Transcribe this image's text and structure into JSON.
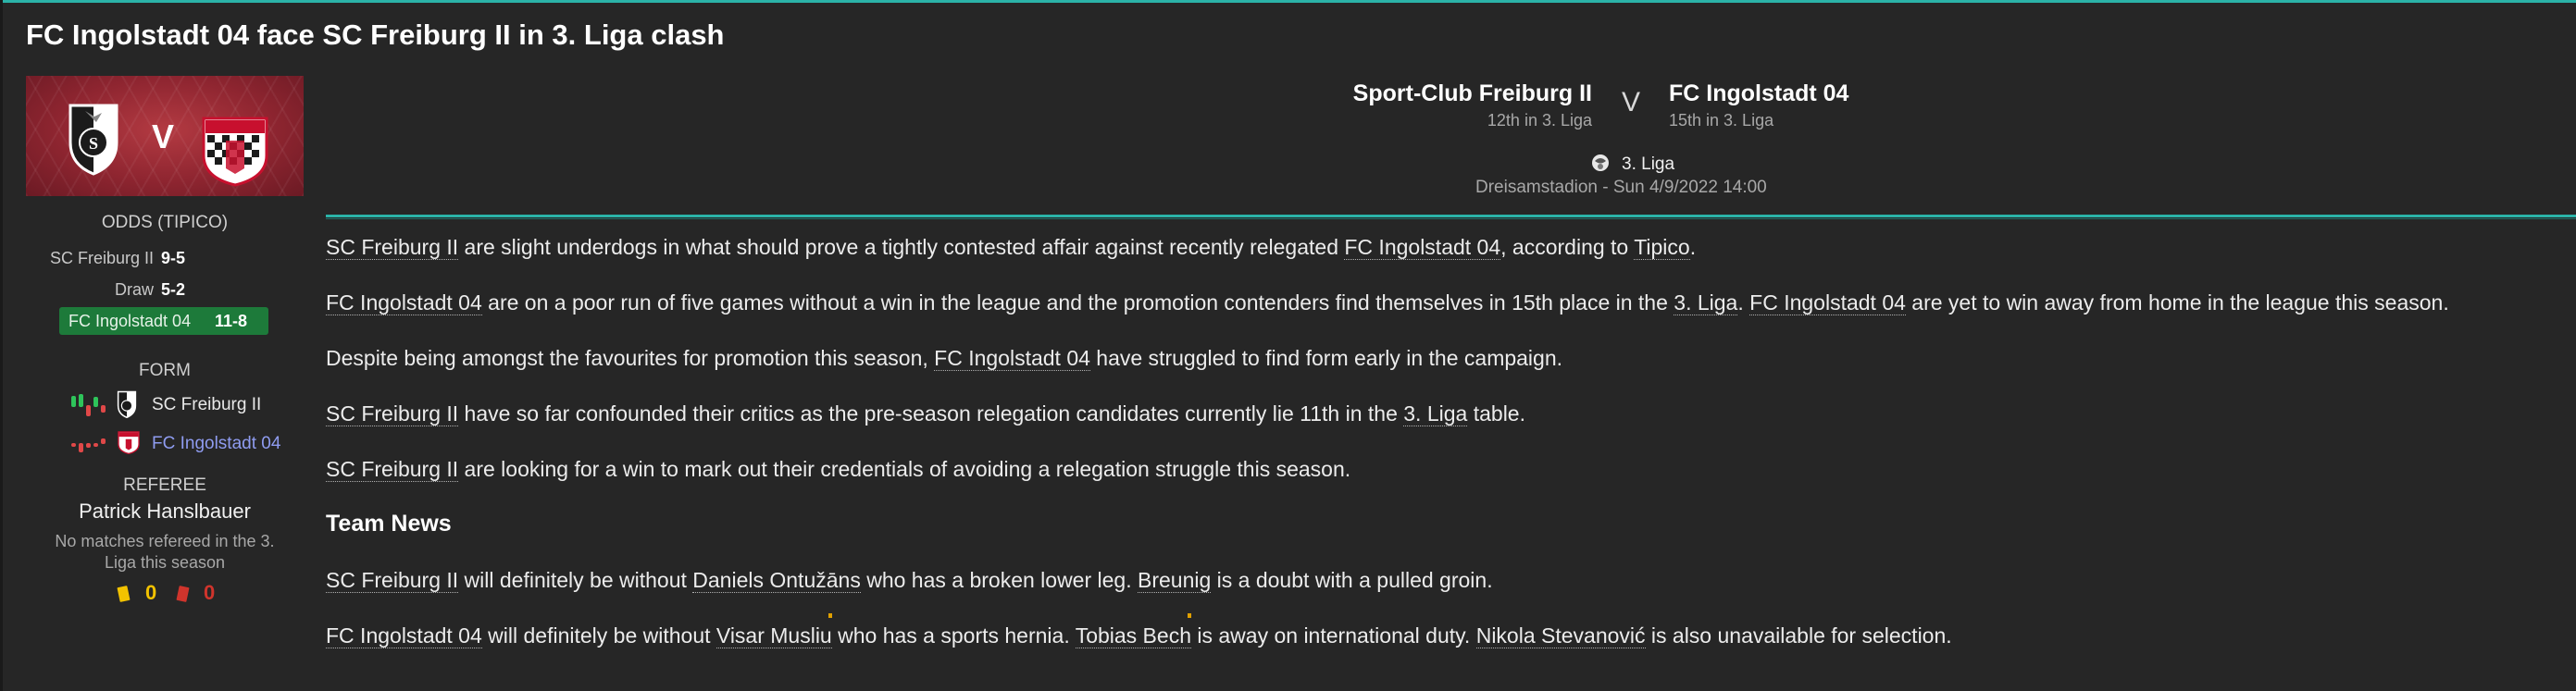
{
  "page": {
    "title": "FC Ingolstadt 04 face SC Freiburg II in 3. Liga clash"
  },
  "banner": {
    "home_icon": "sc-freiburg-crest",
    "away_icon": "fc-ingolstadt-crest",
    "versus": "V"
  },
  "odds": {
    "label": "ODDS (TIPICO)",
    "rows": [
      {
        "name": "SC Freiburg II",
        "value": "9-5"
      },
      {
        "name": "Draw",
        "value": "5-2"
      },
      {
        "name": "FC Ingolstadt 04",
        "value": "11-8",
        "favourite": true
      }
    ],
    "favourite_color": "#1d7a3a"
  },
  "form": {
    "label": "FORM",
    "rows": [
      {
        "team": "SC Freiburg II",
        "color": "#e8e8e8"
      },
      {
        "team": "FC Ingolstadt 04",
        "color": "#8f9cf0"
      }
    ]
  },
  "referee": {
    "label": "REFEREE",
    "name": "Patrick Hanslbauer",
    "note_line1": "No matches refereed in the 3.",
    "note_line2": "Liga this season",
    "yellow_cards": "0",
    "red_cards": "0"
  },
  "match": {
    "home": {
      "name": "Sport-Club Freiburg II",
      "position": "12th in 3. Liga"
    },
    "versus": "V",
    "away": {
      "name": "FC Ingolstadt 04",
      "position": "15th in 3. Liga"
    },
    "competition": "3. Liga",
    "venue": "Dreisamstadion - Sun 4/9/2022 14:00"
  },
  "article": {
    "p1": {
      "a": "SC Freiburg II",
      "b": " are slight underdogs in what should prove a tightly contested affair against recently relegated ",
      "c": "FC Ingolstadt 04",
      "d": ", according to ",
      "e": "Tipico",
      "f": "."
    },
    "p2": {
      "a": "FC Ingolstadt 04",
      "b": " are on a poor run of five games without a win in the league and the promotion contenders find themselves in 15th place in the ",
      "c": "3. Liga",
      "d": ". ",
      "e": "FC Ingolstadt 04",
      "f": " are yet to win away from home in the league this season."
    },
    "p3": {
      "a": "Despite being amongst the favourites for promotion this season, ",
      "b": "FC Ingolstadt 04",
      "c": " have struggled to find form early in the campaign."
    },
    "p4": {
      "a": "SC Freiburg II",
      "b": " have so far confounded their critics as the pre-season relegation candidates currently lie 11th in the ",
      "c": "3. Liga",
      "d": " table."
    },
    "p5": {
      "a": "SC Freiburg II",
      "b": " are looking for a win to mark out their credentials of avoiding a relegation struggle this season."
    },
    "team_news_heading": "Team News",
    "p6": {
      "a": "SC Freiburg II",
      "b": " will definitely be without ",
      "c": "Daniels Ontužāns",
      "d": " who has a broken lower leg. ",
      "e": "Breunig",
      "f": " is a doubt with a pulled groin."
    },
    "p7": {
      "a": "FC Ingolstadt 04",
      "b": " will definitely be without ",
      "c": "Visar Musliu",
      "d": " who has a sports hernia. ",
      "e": "Tobias Bech",
      "f": " is away on international duty. ",
      "g": "Nikola Stevanović",
      "h": " is also unavailable for selection."
    }
  }
}
